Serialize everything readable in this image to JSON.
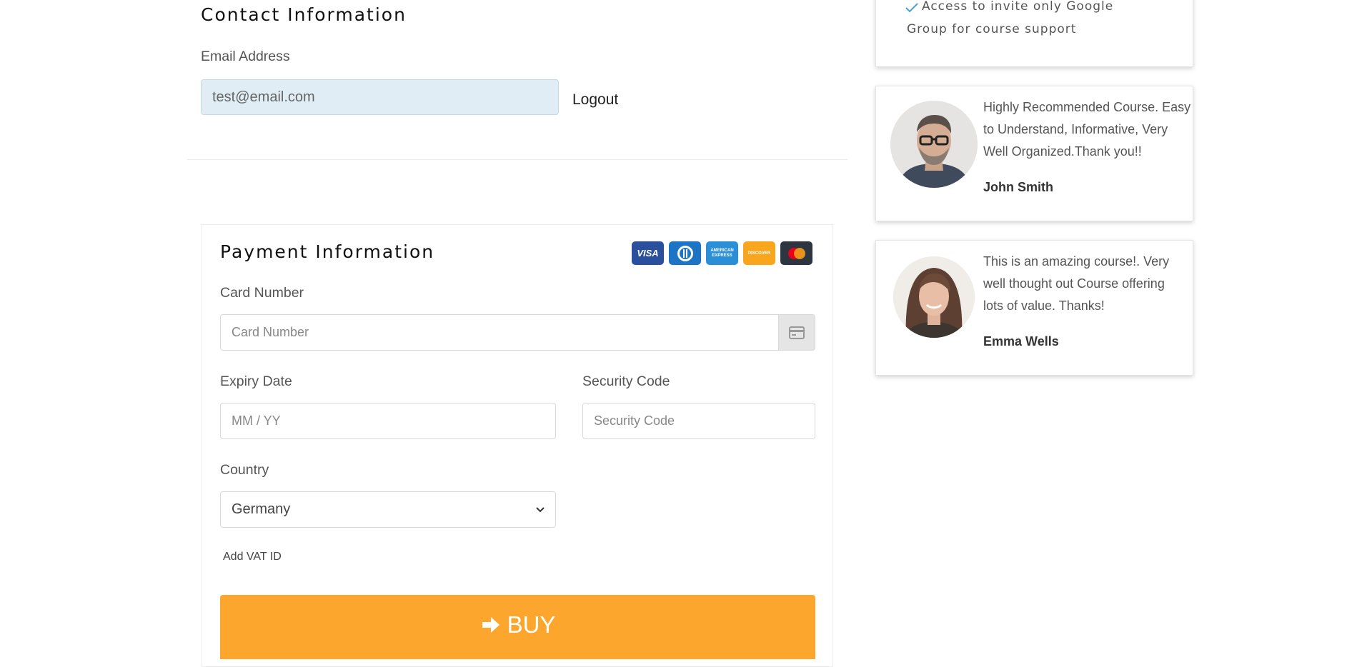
{
  "contact": {
    "title": "Contact Information",
    "email_label": "Email Address",
    "email_value": "test@email.com",
    "logout_label": "Logout"
  },
  "payment": {
    "title": "Payment Information",
    "card_icons": [
      "visa",
      "diners-club",
      "american-express",
      "discover",
      "mastercard"
    ],
    "card_number_label": "Card Number",
    "card_number_placeholder": "Card Number",
    "expiry_label": "Expiry Date",
    "expiry_placeholder": "MM / YY",
    "security_label": "Security Code",
    "security_placeholder": "Security Code",
    "country_label": "Country",
    "country_value": "Germany",
    "vat_link": "Add VAT ID",
    "buy_label": "BUY"
  },
  "sidebar": {
    "feature_line1": "Access to invite only Google",
    "feature_line2": "Group for course support",
    "testimonials": [
      {
        "line1": "Highly Recommended Course. Easy",
        "line2": "to Understand, Informative, Very",
        "line3": "Well Organized.Thank you!!",
        "name": "John Smith"
      },
      {
        "line1": "This is an amazing course!. Very",
        "line2": "well thought out Course offering",
        "line3": "lots of value. Thanks!",
        "name": "Emma Wells"
      }
    ]
  },
  "colors": {
    "buy_button": "#fca62e",
    "email_bg": "#e1edf4",
    "check": "#4a9fd8"
  }
}
